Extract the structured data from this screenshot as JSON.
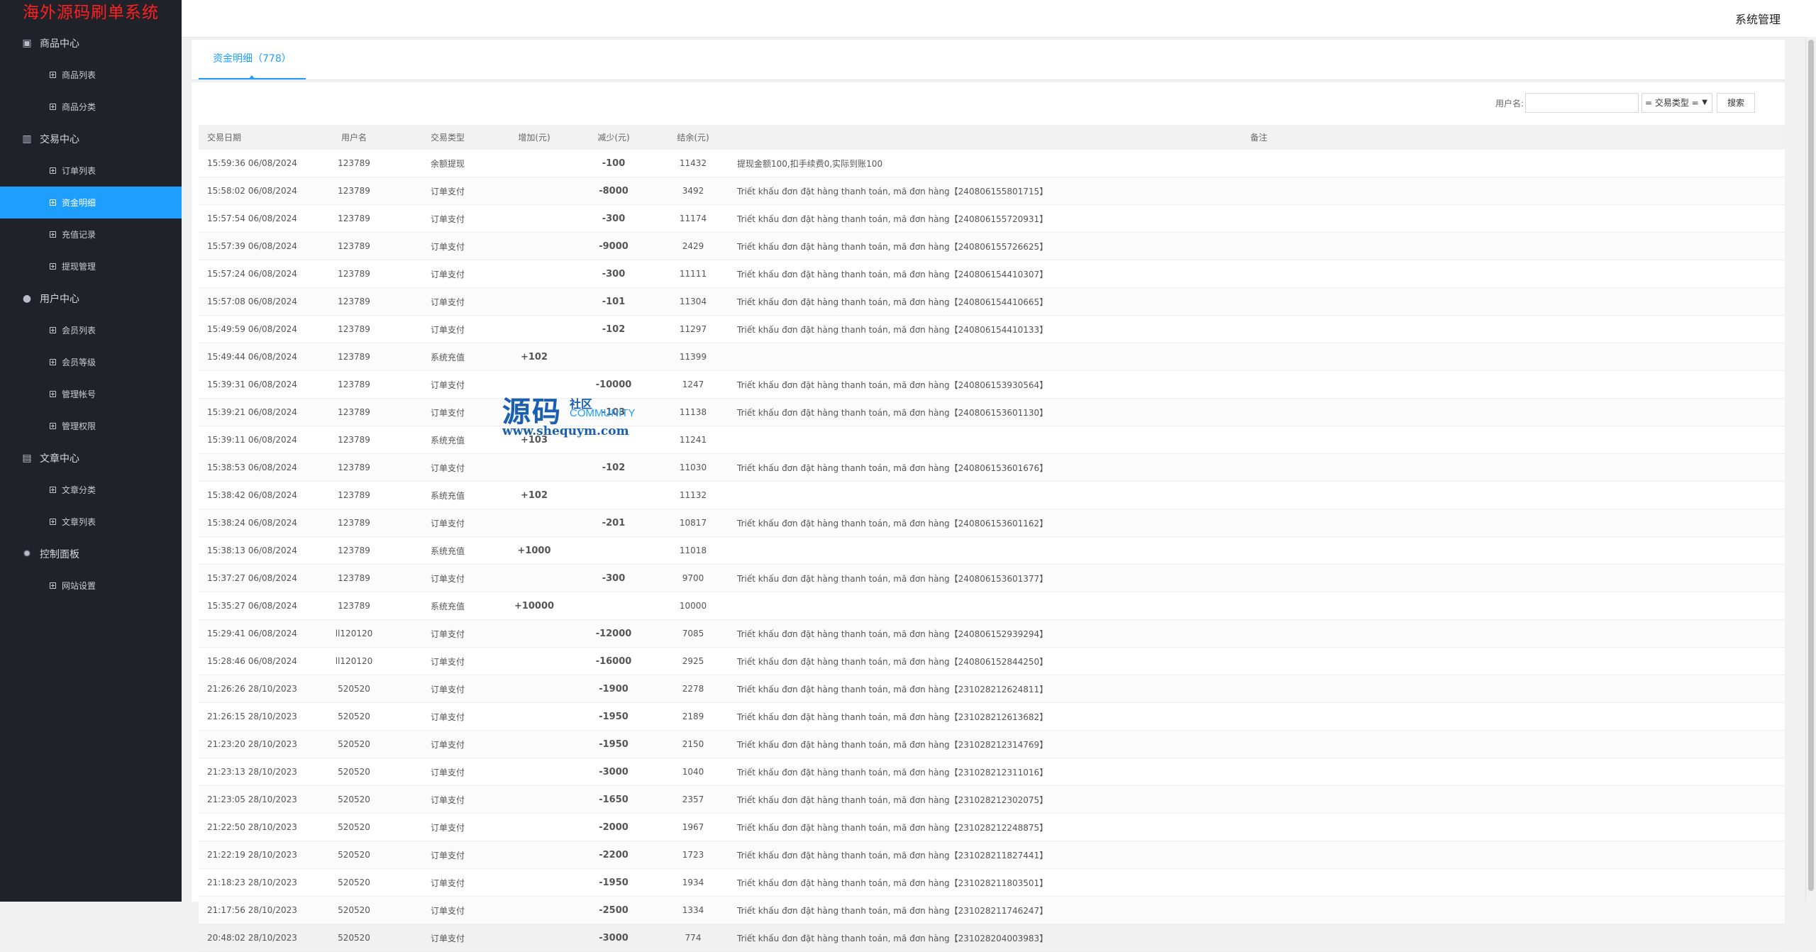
{
  "app": {
    "title": "海外源码刷单系统",
    "admin_label": "系统管理"
  },
  "sidebar": {
    "groups": [
      {
        "label": "商品中心",
        "icon": "clipboard-icon",
        "items": [
          "商品列表",
          "商品分类"
        ]
      },
      {
        "label": "交易中心",
        "icon": "bar-chart-icon",
        "items": [
          "订单列表",
          "资金明细",
          "充值记录",
          "提现管理"
        ]
      },
      {
        "label": "用户中心",
        "icon": "user-icon",
        "items": [
          "会员列表",
          "会员等级",
          "管理帐号",
          "管理权限"
        ]
      },
      {
        "label": "文章中心",
        "icon": "document-icon",
        "items": [
          "文章分类",
          "文章列表"
        ]
      },
      {
        "label": "控制面板",
        "icon": "gear-icon",
        "items": [
          "网站设置"
        ]
      }
    ],
    "active_item": "资金明细"
  },
  "tab": {
    "label": "资金明细（778）"
  },
  "search": {
    "username_label": "用户名:",
    "username_value": "",
    "type_select": "= 交易类型 =",
    "button": "搜索"
  },
  "table": {
    "headers": [
      "交易日期",
      "用户名",
      "交易类型",
      "增加(元)",
      "减少(元)",
      "结余(元)",
      "备注"
    ],
    "rows": [
      [
        "15:59:36 06/08/2024",
        "123789",
        "余额提现",
        "",
        "-100",
        "11432",
        "提现金额100,扣手续费0,实际到账100"
      ],
      [
        "15:58:02 06/08/2024",
        "123789",
        "订单支付",
        "",
        "-8000",
        "3492",
        "Triết khấu đơn đặt hàng thanh toán, mã đơn hàng【240806155801715】"
      ],
      [
        "15:57:54 06/08/2024",
        "123789",
        "订单支付",
        "",
        "-300",
        "11174",
        "Triết khấu đơn đặt hàng thanh toán, mã đơn hàng【240806155720931】"
      ],
      [
        "15:57:39 06/08/2024",
        "123789",
        "订单支付",
        "",
        "-9000",
        "2429",
        "Triết khấu đơn đặt hàng thanh toán, mã đơn hàng【240806155726625】"
      ],
      [
        "15:57:24 06/08/2024",
        "123789",
        "订单支付",
        "",
        "-300",
        "11111",
        "Triết khấu đơn đặt hàng thanh toán, mã đơn hàng【240806154410307】"
      ],
      [
        "15:57:08 06/08/2024",
        "123789",
        "订单支付",
        "",
        "-101",
        "11304",
        "Triết khấu đơn đặt hàng thanh toán, mã đơn hàng【240806154410665】"
      ],
      [
        "15:49:59 06/08/2024",
        "123789",
        "订单支付",
        "",
        "-102",
        "11297",
        "Triết khấu đơn đặt hàng thanh toán, mã đơn hàng【240806154410133】"
      ],
      [
        "15:49:44 06/08/2024",
        "123789",
        "系统充值",
        "+102",
        "",
        "11399",
        ""
      ],
      [
        "15:39:31 06/08/2024",
        "123789",
        "订单支付",
        "",
        "-10000",
        "1247",
        "Triết khấu đơn đặt hàng thanh toán, mã đơn hàng【240806153930564】"
      ],
      [
        "15:39:21 06/08/2024",
        "123789",
        "订单支付",
        "",
        "-103",
        "11138",
        "Triết khấu đơn đặt hàng thanh toán, mã đơn hàng【240806153601130】"
      ],
      [
        "15:39:11 06/08/2024",
        "123789",
        "系统充值",
        "+103",
        "",
        "11241",
        ""
      ],
      [
        "15:38:53 06/08/2024",
        "123789",
        "订单支付",
        "",
        "-102",
        "11030",
        "Triết khấu đơn đặt hàng thanh toán, mã đơn hàng【240806153601676】"
      ],
      [
        "15:38:42 06/08/2024",
        "123789",
        "系统充值",
        "+102",
        "",
        "11132",
        ""
      ],
      [
        "15:38:24 06/08/2024",
        "123789",
        "订单支付",
        "",
        "-201",
        "10817",
        "Triết khấu đơn đặt hàng thanh toán, mã đơn hàng【240806153601162】"
      ],
      [
        "15:38:13 06/08/2024",
        "123789",
        "系统充值",
        "+1000",
        "",
        "11018",
        ""
      ],
      [
        "15:37:27 06/08/2024",
        "123789",
        "订单支付",
        "",
        "-300",
        "9700",
        "Triết khấu đơn đặt hàng thanh toán, mã đơn hàng【240806153601377】"
      ],
      [
        "15:35:27 06/08/2024",
        "123789",
        "系统充值",
        "+10000",
        "",
        "10000",
        ""
      ],
      [
        "15:29:41 06/08/2024",
        "ll120120",
        "订单支付",
        "",
        "-12000",
        "7085",
        "Triết khấu đơn đặt hàng thanh toán, mã đơn hàng【240806152939294】"
      ],
      [
        "15:28:46 06/08/2024",
        "ll120120",
        "订单支付",
        "",
        "-16000",
        "2925",
        "Triết khấu đơn đặt hàng thanh toán, mã đơn hàng【240806152844250】"
      ],
      [
        "21:26:26 28/10/2023",
        "520520",
        "订单支付",
        "",
        "-1900",
        "2278",
        "Triết khấu đơn đặt hàng thanh toán, mã đơn hàng【231028212624811】"
      ],
      [
        "21:26:15 28/10/2023",
        "520520",
        "订单支付",
        "",
        "-1950",
        "2189",
        "Triết khấu đơn đặt hàng thanh toán, mã đơn hàng【231028212613682】"
      ],
      [
        "21:23:20 28/10/2023",
        "520520",
        "订单支付",
        "",
        "-1950",
        "2150",
        "Triết khấu đơn đặt hàng thanh toán, mã đơn hàng【231028212314769】"
      ],
      [
        "21:23:13 28/10/2023",
        "520520",
        "订单支付",
        "",
        "-3000",
        "1040",
        "Triết khấu đơn đặt hàng thanh toán, mã đơn hàng【231028212311016】"
      ],
      [
        "21:23:05 28/10/2023",
        "520520",
        "订单支付",
        "",
        "-1650",
        "2357",
        "Triết khấu đơn đặt hàng thanh toán, mã đơn hàng【231028212302075】"
      ],
      [
        "21:22:50 28/10/2023",
        "520520",
        "订单支付",
        "",
        "-2000",
        "1967",
        "Triết khấu đơn đặt hàng thanh toán, mã đơn hàng【231028212248875】"
      ],
      [
        "21:22:19 28/10/2023",
        "520520",
        "订单支付",
        "",
        "-2200",
        "1723",
        "Triết khấu đơn đặt hàng thanh toán, mã đơn hàng【231028211827441】"
      ],
      [
        "21:18:23 28/10/2023",
        "520520",
        "订单支付",
        "",
        "-1950",
        "1934",
        "Triết khấu đơn đặt hàng thanh toán, mã đơn hàng【231028211803501】"
      ],
      [
        "21:17:56 28/10/2023",
        "520520",
        "订单支付",
        "",
        "-2500",
        "1334",
        "Triết khấu đơn đặt hàng thanh toán, mã đơn hàng【231028211746247】"
      ],
      [
        "20:48:02 28/10/2023",
        "520520",
        "订单支付",
        "",
        "-3000",
        "774",
        "Triết khấu đơn đặt hàng thanh toán, mã đơn hàng【231028204003983】"
      ]
    ]
  },
  "watermark": {
    "big": "源码",
    "small1": "社区",
    "small2": "COMMUNITY",
    "url": "www.shequym.com"
  },
  "colors": {
    "sidebar_bg": "#20222a",
    "accent": "#1e9fff",
    "negative": "#b1052a",
    "positive": "#2ea44f",
    "brand": "#ff2020"
  }
}
